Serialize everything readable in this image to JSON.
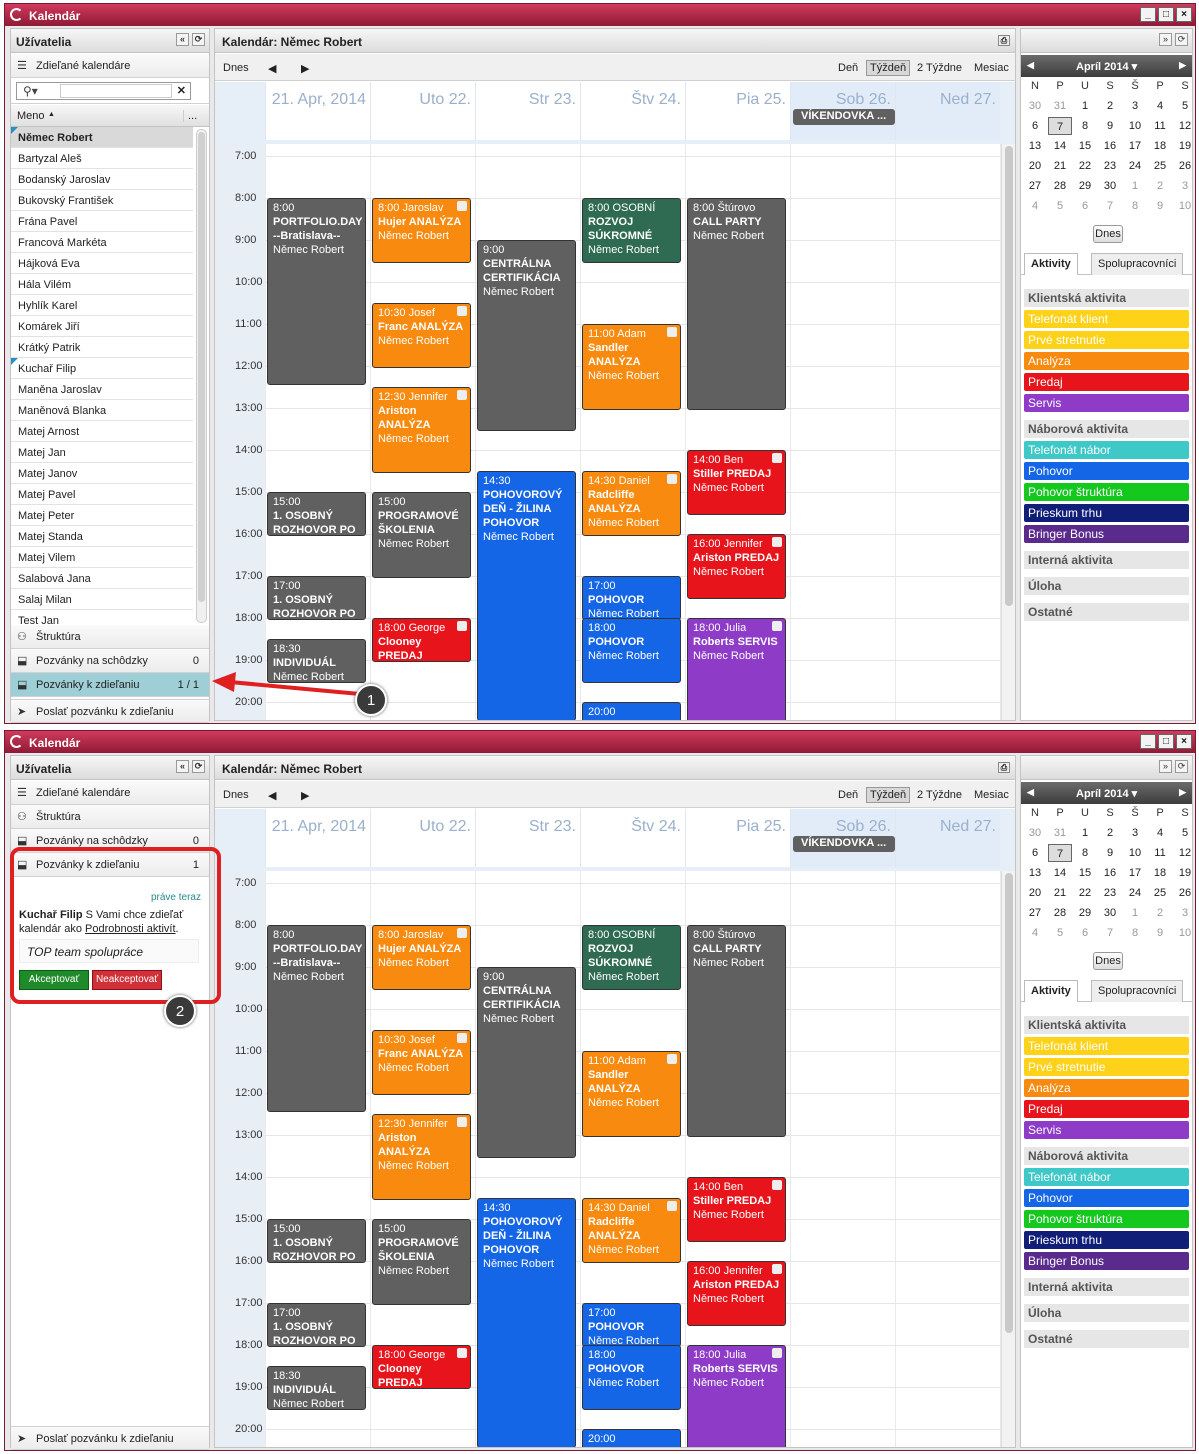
{
  "app": {
    "title": "Kalendár",
    "window_buttons": [
      "_",
      "□",
      "×"
    ]
  },
  "users_panel": {
    "title": "Užívatelia",
    "shared_calendars": "Zdieľané kalendáre",
    "search_placeholder": "",
    "col_name": "Meno",
    "col_more": "...",
    "users": [
      "Němec Robert",
      "Bartyzal Aleš",
      "Bodanský Jaroslav",
      "Bukovský František",
      "Frána Pavel",
      "Francová Markéta",
      "Hájková Eva",
      "Hála Vilém",
      "Hyhlík Karel",
      "Komárek Jiří",
      "Krátký Patrik",
      "Kuchař Filip",
      "Maněna Jaroslav",
      "Maněnová Blanka",
      "Matej Arnost",
      "Matej Jan",
      "Matej Janov",
      "Matej Pavel",
      "Matej Peter",
      "Matej Standa",
      "Matej Vilem",
      "Salabová Jana",
      "Salaj Milan",
      "Test Jan"
    ],
    "structure": "Štruktúra",
    "meeting_invites": "Pozvánky na schôdzky",
    "meeting_count": "0",
    "share_invites": "Pozvánky k zdieľaniu",
    "share_count_1": "1 / 1",
    "share_count_2": "1",
    "send_invite": "Poslať pozvánku k zdieľaniu"
  },
  "invite": {
    "time": "práve teraz",
    "user": "Kuchař Filip",
    "text1": " S Vami chce zdieľať kalendár ako ",
    "link": "Podrobnosti aktivít",
    "text2": ".",
    "note": "TOP team spolupráce",
    "accept": "Akceptovať",
    "reject": "Neakceptovať"
  },
  "calendar": {
    "title": "Kalendár: Němec Robert",
    "toolbar": {
      "today": "Dnes",
      "prev": "◀",
      "next": "▶",
      "day": "Deň",
      "week": "Týždeň",
      "two_weeks": "2 Týždne",
      "month": "Mesiac"
    },
    "days": [
      "21. Apr, 2014",
      "Uto 22.",
      "Str 23.",
      "Štv 24.",
      "Pia 25.",
      "Sob 26.",
      "Ned 27."
    ],
    "weekend_event": "VÍKENDOVKA ...",
    "hours": [
      "7:00",
      "8:00",
      "9:00",
      "10:00",
      "11:00",
      "12:00",
      "13:00",
      "14:00",
      "15:00",
      "16:00",
      "17:00",
      "18:00",
      "19:00",
      "20:00"
    ],
    "events": [
      {
        "day": 0,
        "start": 8,
        "end": 12.5,
        "color": "#606060",
        "t1": "8:00",
        "t2": "PORTFOLIO.DAY",
        "t3": "--Bratislava--",
        "t4": "Němec Robert",
        "lock": false
      },
      {
        "day": 0,
        "start": 15,
        "end": 16.1,
        "color": "#606060",
        "t1": "15:00",
        "t2": "1. OSOBNÝ ROZHOVOR PO",
        "t3": "",
        "t4": "",
        "lock": false
      },
      {
        "day": 0,
        "start": 17,
        "end": 18.1,
        "color": "#606060",
        "t1": "17:00",
        "t2": "1. OSOBNÝ ROZHOVOR PO",
        "t3": "",
        "t4": "",
        "lock": false
      },
      {
        "day": 0,
        "start": 18.5,
        "end": 19.6,
        "color": "#606060",
        "t1": "18:30",
        "t2": "INDIVIDUÁL",
        "t3": "",
        "t4": "Němec Robert",
        "lock": false
      },
      {
        "day": 1,
        "start": 8,
        "end": 9.6,
        "color": "#f78a0f",
        "t1": "8:00 Jaroslav",
        "t2": "Hujer ANALÝZA",
        "t3": "",
        "t4": "Němec Robert",
        "lock": true
      },
      {
        "day": 1,
        "start": 10.5,
        "end": 12.1,
        "color": "#f78a0f",
        "t1": "10:30 Josef",
        "t2": "Franc ANALÝZA",
        "t3": "",
        "t4": "Němec Robert",
        "lock": true
      },
      {
        "day": 1,
        "start": 12.5,
        "end": 14.6,
        "color": "#f78a0f",
        "t1": "12:30 Jennifer",
        "t2": "Ariston",
        "t3": "ANALÝZA",
        "t4": "Němec Robert",
        "lock": true
      },
      {
        "day": 1,
        "start": 15,
        "end": 17.1,
        "color": "#606060",
        "t1": "15:00",
        "t2": "PROGRAMOVÉ ŠKOLENIA",
        "t3": "",
        "t4": "Němec Robert",
        "lock": false
      },
      {
        "day": 1,
        "start": 18,
        "end": 19.1,
        "color": "#e8141c",
        "t1": "18:00 George",
        "t2": "Clooney PREDAJ",
        "t3": "",
        "t4": "Němec Robert",
        "lock": true
      },
      {
        "day": 2,
        "start": 9,
        "end": 13.6,
        "color": "#606060",
        "t1": "9:00",
        "t2": "CENTRÁLNA CERTIFIKÁCIA",
        "t3": "",
        "t4": "Němec Robert",
        "lock": false
      },
      {
        "day": 2,
        "start": 14.5,
        "end": 20.5,
        "color": "#1466e6",
        "t1": "14:30",
        "t2": "POHOVOROVÝ DEŇ - ŽILINA",
        "t3": "POHOVOR",
        "t4": "Němec Robert",
        "lock": false
      },
      {
        "day": 3,
        "start": 8,
        "end": 9.6,
        "color": "#2e6b52",
        "t1": "8:00 OSOBNÍ",
        "t2": "ROZVOJ SÚKROMNÉ",
        "t3": "",
        "t4": "Němec Robert",
        "lock": false
      },
      {
        "day": 3,
        "start": 11,
        "end": 13.1,
        "color": "#f78a0f",
        "t1": "11:00 Adam",
        "t2": "Sandler",
        "t3": "ANALÝZA",
        "t4": "Němec Robert",
        "lock": true
      },
      {
        "day": 3,
        "start": 14.5,
        "end": 16.1,
        "color": "#f78a0f",
        "t1": "14:30 Daniel",
        "t2": "Radcliffe",
        "t3": "ANALÝZA",
        "t4": "Němec Robert",
        "lock": true
      },
      {
        "day": 3,
        "start": 17,
        "end": 18.1,
        "color": "#1466e6",
        "t1": "17:00",
        "t2": "POHOVOR",
        "t3": "",
        "t4": "Němec Robert",
        "lock": false
      },
      {
        "day": 3,
        "start": 18,
        "end": 19.6,
        "color": "#1466e6",
        "t1": "18:00",
        "t2": "POHOVOR",
        "t3": "",
        "t4": "Němec Robert",
        "lock": false
      },
      {
        "day": 3,
        "start": 20,
        "end": 21,
        "color": "#1466e6",
        "t1": "20:00",
        "t2": "POHOVOR",
        "t3": "",
        "t4": "Němec Robert",
        "lock": false
      },
      {
        "day": 4,
        "start": 8,
        "end": 13.1,
        "color": "#606060",
        "t1": "8:00 Štúrovo",
        "t2": "CALL PARTY",
        "t3": "",
        "t4": "Němec Robert",
        "lock": false
      },
      {
        "day": 4,
        "start": 14,
        "end": 15.6,
        "color": "#e8141c",
        "t1": "14:00 Ben",
        "t2": "Stiller PREDAJ",
        "t3": "",
        "t4": "Němec Robert",
        "lock": true
      },
      {
        "day": 4,
        "start": 16,
        "end": 17.6,
        "color": "#e8141c",
        "t1": "16:00 Jennifer",
        "t2": "Ariston PREDAJ",
        "t3": "",
        "t4": "Němec Robert",
        "lock": true
      },
      {
        "day": 4,
        "start": 18,
        "end": 20.6,
        "color": "#8e3cc8",
        "t1": "18:00 Julia",
        "t2": "Roberts SERVIS",
        "t3": "",
        "t4": "Němec Robert",
        "lock": true
      }
    ]
  },
  "mini_calendar": {
    "month": "Apríl 2014 ▾",
    "headers": [
      "N",
      "P",
      "U",
      "S",
      "Š",
      "P",
      "S"
    ],
    "weeks": [
      [
        30,
        31,
        1,
        2,
        3,
        4,
        5
      ],
      [
        6,
        7,
        8,
        9,
        10,
        11,
        12
      ],
      [
        13,
        14,
        15,
        16,
        17,
        18,
        19
      ],
      [
        20,
        21,
        22,
        23,
        24,
        25,
        26
      ],
      [
        27,
        28,
        29,
        30,
        1,
        2,
        3
      ],
      [
        4,
        5,
        6,
        7,
        8,
        9,
        10
      ]
    ],
    "today_button": "Dnes",
    "tab_activities": "Aktivity",
    "tab_colleagues": "Spolupracovníci",
    "sections": [
      {
        "title": "Klientská aktivita",
        "items": [
          {
            "label": "Telefonát klient",
            "color": "#ffd21a"
          },
          {
            "label": "Prvé stretnutie",
            "color": "#ffd21a"
          },
          {
            "label": "Analýza",
            "color": "#f78a0f"
          },
          {
            "label": "Predaj",
            "color": "#e8141c"
          },
          {
            "label": "Servis",
            "color": "#8e3cc8"
          }
        ]
      },
      {
        "title": "Náborová aktivita",
        "items": [
          {
            "label": "Telefonát nábor",
            "color": "#3ec8c8"
          },
          {
            "label": "Pohovor",
            "color": "#1466e6"
          },
          {
            "label": "Pohovor štruktúra",
            "color": "#14c81e"
          },
          {
            "label": "Prieskum trhu",
            "color": "#101e78"
          },
          {
            "label": "Bringer Bonus",
            "color": "#5a2a8c"
          }
        ]
      },
      {
        "title": "Interná aktivita",
        "items": []
      },
      {
        "title": "Úloha",
        "items": []
      },
      {
        "title": "Ostatné",
        "items": []
      }
    ]
  },
  "callouts": [
    "1",
    "2"
  ]
}
